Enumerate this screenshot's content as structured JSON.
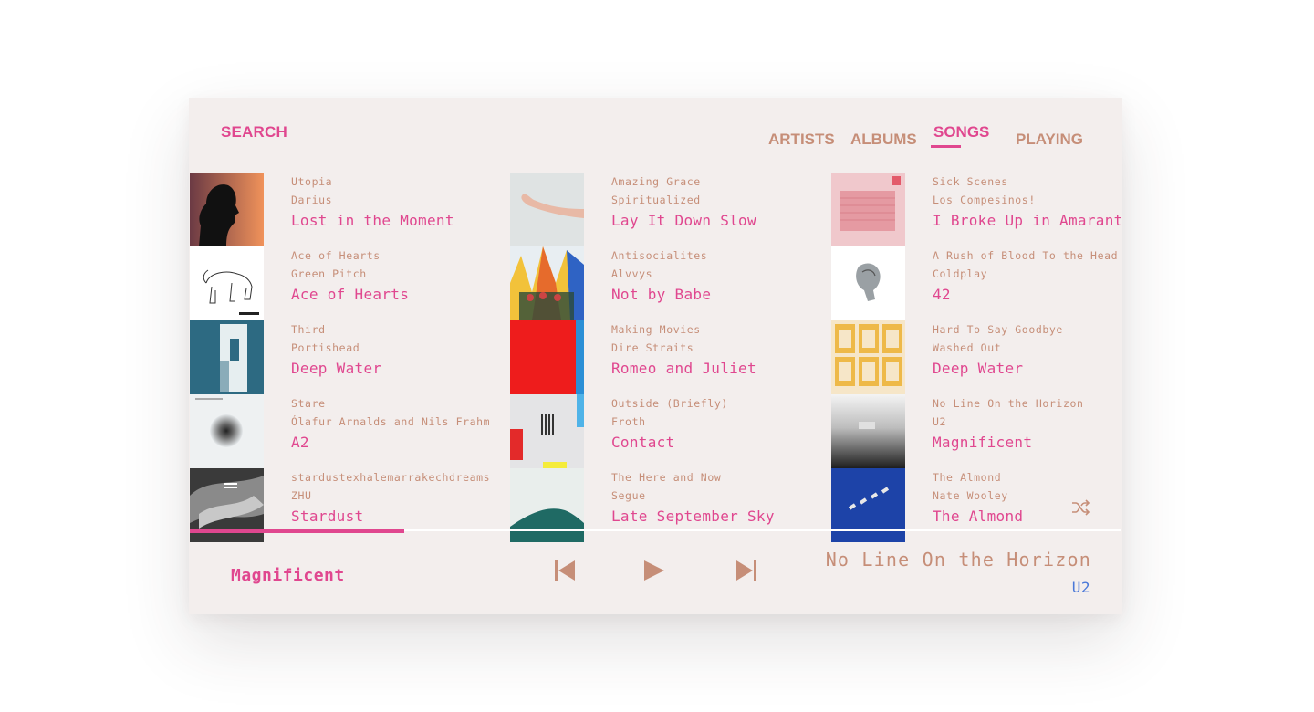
{
  "nav": {
    "search_label": "SEARCH",
    "tabs": [
      {
        "label": "ARTISTS",
        "active": false
      },
      {
        "label": "ALBUMS",
        "active": false
      },
      {
        "label": "SONGS",
        "active": true
      },
      {
        "label": "PLAYING",
        "active": false
      }
    ]
  },
  "songs": [
    {
      "album": "Utopia",
      "artist": "Darius",
      "title": "Lost in the Moment"
    },
    {
      "album": "Ace of Hearts",
      "artist": "Green Pitch",
      "title": "Ace of Hearts"
    },
    {
      "album": "Third",
      "artist": "Portishead",
      "title": "Deep Water"
    },
    {
      "album": "Stare",
      "artist": "Ólafur Arnalds and Nils Frahm",
      "title": "A2"
    },
    {
      "album": "stardustexhalemarrakechdreams",
      "artist": "ZHU",
      "title": "Stardust"
    },
    {
      "album": "Amazing Grace",
      "artist": "Spiritualized",
      "title": "Lay It Down Slow"
    },
    {
      "album": "Antisocialites",
      "artist": "Alvvys",
      "title": "Not by Babe"
    },
    {
      "album": "Making Movies",
      "artist": "Dire Straits",
      "title": "Romeo and Juliet"
    },
    {
      "album": "Outside (Briefly)",
      "artist": "Froth",
      "title": "Contact"
    },
    {
      "album": "The Here and Now",
      "artist": "Segue",
      "title": "Late September Sky"
    },
    {
      "album": "Sick Scenes",
      "artist": "Los Compesinos!",
      "title": "I Broke Up in Amarante"
    },
    {
      "album": "A Rush of Blood To the Head",
      "artist": "Coldplay",
      "title": "42"
    },
    {
      "album": "Hard To Say Goodbye",
      "artist": "Washed Out",
      "title": "Deep Water"
    },
    {
      "album": "No Line On the Horizon",
      "artist": "U2",
      "title": "Magnificent"
    },
    {
      "album": "The Almond",
      "artist": "Nate Wooley",
      "title": "The Almond"
    }
  ],
  "player": {
    "now_playing_title": "Magnificent",
    "album": "No Line On the Horizon",
    "artist": "U2",
    "progress": 0.23
  },
  "icons": {
    "previous": "skip-previous-icon",
    "play": "play-icon",
    "next": "skip-next-icon",
    "shuffle": "shuffle-icon"
  },
  "colors": {
    "accent": "#e0478f",
    "secondary": "#c68e78",
    "artist_link": "#4a78d8",
    "background": "#f3eeed"
  }
}
